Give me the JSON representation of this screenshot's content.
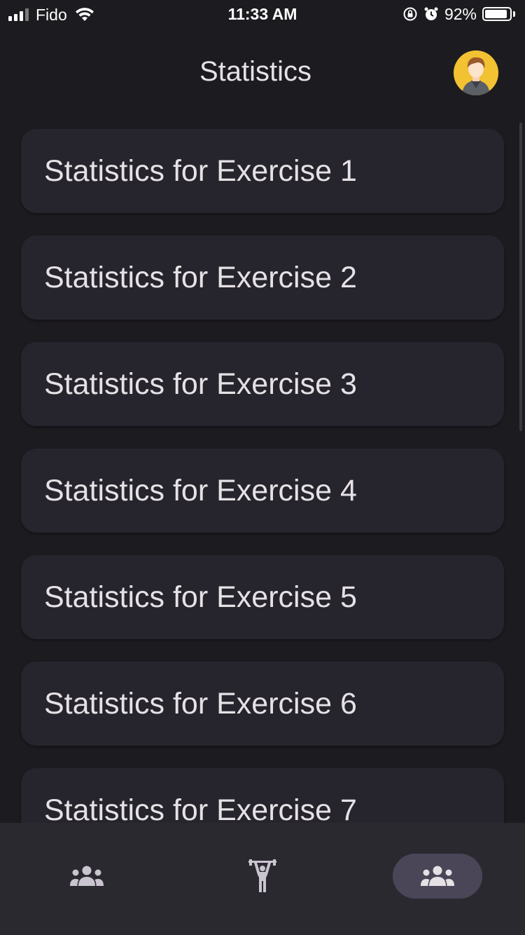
{
  "status_bar": {
    "carrier": "Fido",
    "time": "11:33 AM",
    "battery_percent": "92%",
    "battery_level": 0.92
  },
  "header": {
    "title": "Statistics",
    "avatar_icon": "user-avatar-icon"
  },
  "list": {
    "items": [
      {
        "label": "Statistics for Exercise 1"
      },
      {
        "label": "Statistics for Exercise 2"
      },
      {
        "label": "Statistics for Exercise 3"
      },
      {
        "label": "Statistics for Exercise 4"
      },
      {
        "label": "Statistics for Exercise 5"
      },
      {
        "label": "Statistics for Exercise 6"
      },
      {
        "label": "Statistics for Exercise 7"
      }
    ]
  },
  "bottom_nav": {
    "items": [
      {
        "icon": "group-icon",
        "active": false
      },
      {
        "icon": "weightlifter-icon",
        "active": false
      },
      {
        "icon": "group-icon",
        "active": true
      }
    ]
  },
  "colors": {
    "background": "#1c1b1f",
    "card": "#26252d",
    "nav_background": "#2a2930",
    "nav_active": "#4a4658",
    "text": "#e6e1e5",
    "avatar_background": "#f2c232"
  }
}
